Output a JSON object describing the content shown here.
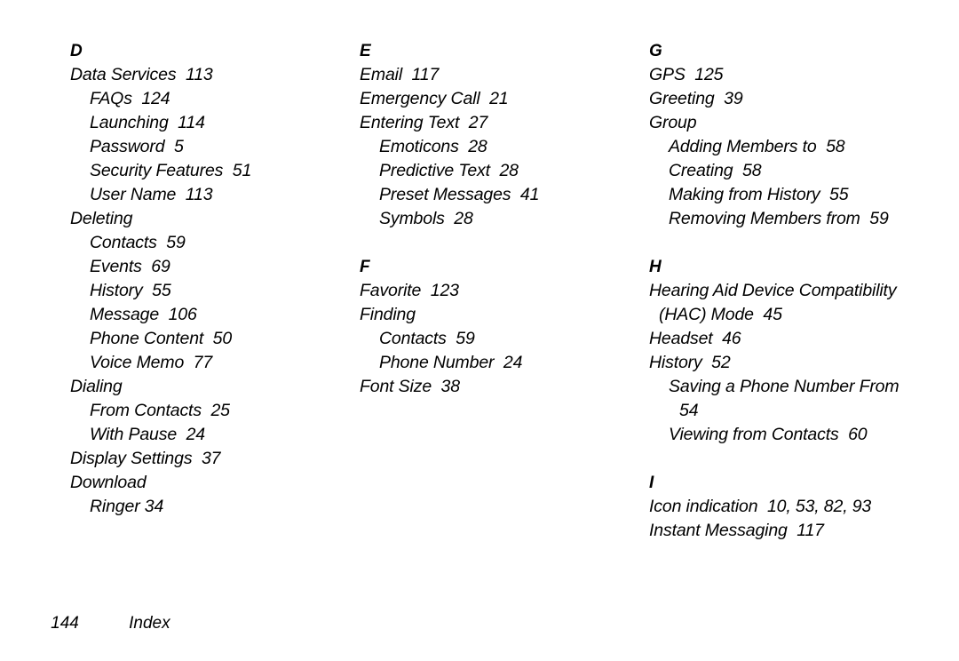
{
  "document": {
    "type": "index",
    "footer": {
      "page_number": "144",
      "label": "Index"
    }
  },
  "columns": [
    {
      "sections": [
        {
          "letter": "D",
          "entries": [
            {
              "level": 0,
              "text": "Data Services  113"
            },
            {
              "level": 1,
              "text": "FAQs  124"
            },
            {
              "level": 1,
              "text": "Launching  114"
            },
            {
              "level": 1,
              "text": "Password  5"
            },
            {
              "level": 1,
              "text": "Security Features  51"
            },
            {
              "level": 1,
              "text": "User Name  113"
            },
            {
              "level": 0,
              "text": "Deleting"
            },
            {
              "level": 1,
              "text": "Contacts  59"
            },
            {
              "level": 1,
              "text": "Events  69"
            },
            {
              "level": 1,
              "text": "History  55"
            },
            {
              "level": 1,
              "text": "Message  106"
            },
            {
              "level": 1,
              "text": "Phone Content  50"
            },
            {
              "level": 1,
              "text": "Voice Memo  77"
            },
            {
              "level": 0,
              "text": "Dialing"
            },
            {
              "level": 1,
              "text": "From Contacts  25"
            },
            {
              "level": 1,
              "text": "With Pause  24"
            },
            {
              "level": 0,
              "text": "Display Settings  37"
            },
            {
              "level": 0,
              "text": "Download"
            },
            {
              "level": 1,
              "text": "Ringer 34"
            }
          ]
        }
      ]
    },
    {
      "sections": [
        {
          "letter": "E",
          "entries": [
            {
              "level": 0,
              "text": "Email  117"
            },
            {
              "level": 0,
              "text": "Emergency Call  21"
            },
            {
              "level": 0,
              "text": "Entering Text  27"
            },
            {
              "level": 1,
              "text": "Emoticons  28"
            },
            {
              "level": 1,
              "text": "Predictive Text  28"
            },
            {
              "level": 1,
              "text": "Preset Messages  41"
            },
            {
              "level": 1,
              "text": "Symbols  28"
            }
          ]
        },
        {
          "letter": "F",
          "entries": [
            {
              "level": 0,
              "text": "Favorite  123"
            },
            {
              "level": 0,
              "text": "Finding"
            },
            {
              "level": 1,
              "text": "Contacts  59"
            },
            {
              "level": 1,
              "text": "Phone Number  24"
            },
            {
              "level": 0,
              "text": "Font Size  38"
            }
          ]
        }
      ]
    },
    {
      "sections": [
        {
          "letter": "G",
          "entries": [
            {
              "level": 0,
              "text": "GPS  125"
            },
            {
              "level": 0,
              "text": "Greeting  39"
            },
            {
              "level": 0,
              "text": "Group"
            },
            {
              "level": 1,
              "text": "Adding Members to  58"
            },
            {
              "level": 1,
              "text": "Creating  58"
            },
            {
              "level": 1,
              "text": "Making from History  55"
            },
            {
              "level": 1,
              "text": "Removing Members from  59"
            }
          ]
        },
        {
          "letter": "H",
          "entries": [
            {
              "level": 0,
              "text": "Hearing Aid Device Compatibility (HAC) Mode  45"
            },
            {
              "level": 0,
              "text": "Headset  46"
            },
            {
              "level": 0,
              "text": "History  52"
            },
            {
              "level": 1,
              "text": "Saving a Phone Number From  54"
            },
            {
              "level": 1,
              "text": "Viewing from Contacts  60"
            }
          ]
        },
        {
          "letter": "I",
          "entries": [
            {
              "level": 0,
              "text": "Icon indication  10, 53, 82, 93"
            },
            {
              "level": 0,
              "text": "Instant Messaging  117"
            }
          ]
        }
      ]
    }
  ]
}
